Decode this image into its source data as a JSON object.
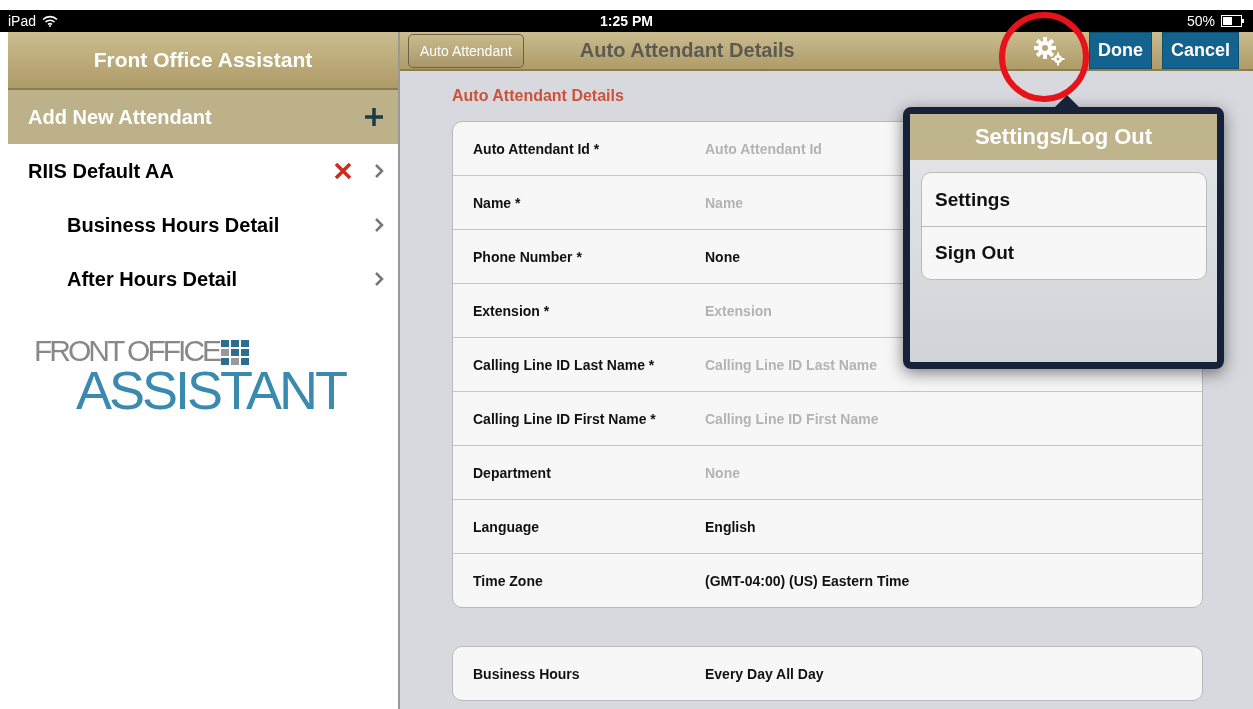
{
  "status_bar": {
    "device": "iPad",
    "time": "1:25 PM",
    "battery": "50%"
  },
  "master": {
    "title": "Front Office Assistant",
    "add_label": "Add New Attendant",
    "items": [
      {
        "label": "RIIS Default AA",
        "deletable": true,
        "children": [
          {
            "label": "Business Hours Detail",
            "deletable": false
          },
          {
            "label": "After Hours Detail",
            "deletable": false
          }
        ]
      }
    ],
    "logo": {
      "line1": "FRONT OFFICE",
      "line2": "ASSISTANT"
    }
  },
  "detail": {
    "back_button": "Auto Attendant",
    "title": "Auto Attendant Details",
    "done_button": "Done",
    "cancel_button": "Cancel",
    "section_title": "Auto Attendant Details",
    "sections": [
      [
        {
          "label": "Auto Attendant Id *",
          "placeholder": "Auto Attendant Id"
        },
        {
          "label": "Name *",
          "placeholder": "Name"
        },
        {
          "label": "Phone Number *",
          "value": "None"
        },
        {
          "label": "Extension *",
          "placeholder": "Extension"
        },
        {
          "label": "Calling Line ID Last Name *",
          "placeholder": "Calling Line ID Last Name"
        },
        {
          "label": "Calling Line ID First Name *",
          "placeholder": "Calling Line ID First Name"
        },
        {
          "label": "Department",
          "placeholder": "None"
        },
        {
          "label": "Language",
          "value": "English"
        },
        {
          "label": "Time Zone",
          "value": "(GMT-04:00) (US) Eastern Time"
        }
      ],
      [
        {
          "label": "Business Hours",
          "value": "Every Day All Day"
        }
      ]
    ]
  },
  "popover": {
    "title": "Settings/Log Out",
    "items": [
      "Settings",
      "Sign Out"
    ]
  }
}
